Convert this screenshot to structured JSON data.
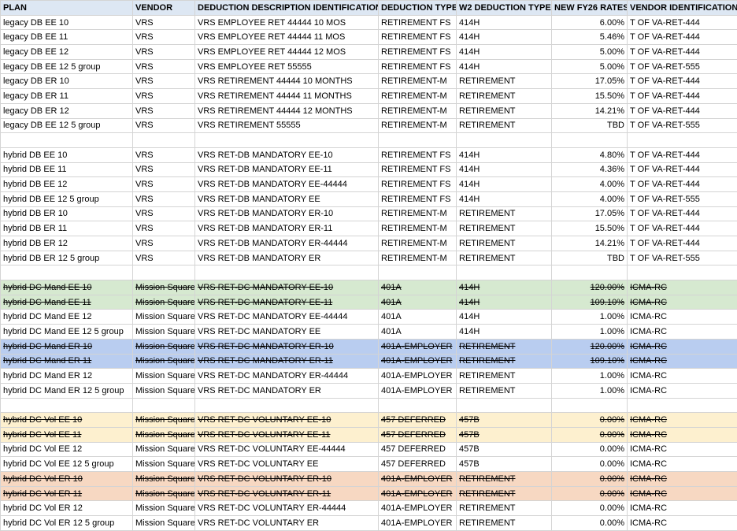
{
  "colors": {
    "header_fill": "#dde7f3",
    "green_fill": "#d6e9d0",
    "blue_fill": "#b9cdf0",
    "yellow_fill": "#fdf0cf",
    "orange_fill": "#f7d8c2",
    "grid": "#d4d4d4"
  },
  "headers": [
    "PLAN",
    "VENDOR",
    "DEDUCTION DESCRIPTION IDENTIFICATION",
    "DEDUCTION TYPE",
    "W2 DEDUCTION TYPE",
    "NEW FY26 RATES",
    "VENDOR IDENTIFICATION"
  ],
  "rows": [
    {
      "cells": [
        "legacy DB EE 10",
        "VRS",
        "VRS EMPLOYEE RET 44444 10 MOS",
        "RETIREMENT FS",
        "414H",
        "6.00%",
        "T OF VA-RET-444"
      ],
      "fill": "",
      "strike": false
    },
    {
      "cells": [
        "legacy DB EE 11",
        "VRS",
        "VRS EMPLOYEE RET 44444 11 MOS",
        "RETIREMENT FS",
        "414H",
        "5.46%",
        "T OF VA-RET-444"
      ],
      "fill": "",
      "strike": false
    },
    {
      "cells": [
        "legacy DB EE 12",
        "VRS",
        "VRS EMPLOYEE RET 44444 12 MOS",
        "RETIREMENT FS",
        "414H",
        "5.00%",
        "T OF VA-RET-444"
      ],
      "fill": "",
      "strike": false
    },
    {
      "cells": [
        "legacy DB EE 12 5 group",
        "VRS",
        "VRS EMPLOYEE RET 55555",
        "RETIREMENT FS",
        "414H",
        "5.00%",
        "T OF VA-RET-555"
      ],
      "fill": "",
      "strike": false
    },
    {
      "cells": [
        "legacy DB ER 10",
        "VRS",
        "VRS RETIREMENT 44444 10 MONTHS",
        "RETIREMENT-M",
        "RETIREMENT",
        "17.05%",
        "T OF VA-RET-444"
      ],
      "fill": "",
      "strike": false
    },
    {
      "cells": [
        "legacy DB ER 11",
        "VRS",
        "VRS RETIREMENT 44444 11 MONTHS",
        "RETIREMENT-M",
        "RETIREMENT",
        "15.50%",
        "T OF VA-RET-444"
      ],
      "fill": "",
      "strike": false
    },
    {
      "cells": [
        "legacy DB ER 12",
        "VRS",
        "VRS RETIREMENT 44444 12 MONTHS",
        "RETIREMENT-M",
        "RETIREMENT",
        "14.21%",
        "T OF VA-RET-444"
      ],
      "fill": "",
      "strike": false
    },
    {
      "cells": [
        "legacy DB EE 12 5 group",
        "VRS",
        "VRS RETIREMENT 55555",
        "RETIREMENT-M",
        "RETIREMENT",
        "TBD",
        "T OF VA-RET-555"
      ],
      "fill": "",
      "strike": false
    },
    {
      "cells": [
        "",
        "",
        "",
        "",
        "",
        "",
        ""
      ],
      "fill": "blank",
      "strike": false
    },
    {
      "cells": [
        "hybrid DB EE 10",
        "VRS",
        "VRS RET-DB MANDATORY EE-10",
        "RETIREMENT FS",
        "414H",
        "4.80%",
        "T OF VA-RET-444"
      ],
      "fill": "",
      "strike": false
    },
    {
      "cells": [
        "hybrid DB EE 11",
        "VRS",
        "VRS RET-DB MANDATORY EE-11",
        "RETIREMENT FS",
        "414H",
        "4.36%",
        "T OF VA-RET-444"
      ],
      "fill": "",
      "strike": false
    },
    {
      "cells": [
        "hybrid DB EE 12",
        "VRS",
        "VRS RET-DB MANDATORY EE-44444",
        "RETIREMENT FS",
        "414H",
        "4.00%",
        "T OF VA-RET-444"
      ],
      "fill": "",
      "strike": false
    },
    {
      "cells": [
        "hybrid DB EE 12 5 group",
        "VRS",
        "VRS RET-DB MANDATORY EE",
        "RETIREMENT FS",
        "414H",
        "4.00%",
        "T OF VA-RET-555"
      ],
      "fill": "",
      "strike": false
    },
    {
      "cells": [
        "hybrid DB ER 10",
        "VRS",
        "VRS RET-DB MANDATORY ER-10",
        "RETIREMENT-M",
        "RETIREMENT",
        "17.05%",
        "T OF VA-RET-444"
      ],
      "fill": "",
      "strike": false
    },
    {
      "cells": [
        "hybrid DB ER 11",
        "VRS",
        "VRS RET-DB MANDATORY ER-11",
        "RETIREMENT-M",
        "RETIREMENT",
        "15.50%",
        "T OF VA-RET-444"
      ],
      "fill": "",
      "strike": false
    },
    {
      "cells": [
        "hybrid DB ER 12",
        "VRS",
        "VRS RET-DB MANDATORY ER-44444",
        "RETIREMENT-M",
        "RETIREMENT",
        "14.21%",
        "T OF VA-RET-444"
      ],
      "fill": "",
      "strike": false
    },
    {
      "cells": [
        "hybrid DB ER 12 5 group",
        "VRS",
        "VRS RET-DB MANDATORY ER",
        "RETIREMENT-M",
        "RETIREMENT",
        "TBD",
        "T OF VA-RET-555"
      ],
      "fill": "",
      "strike": false
    },
    {
      "cells": [
        "",
        "",
        "",
        "",
        "",
        "",
        ""
      ],
      "fill": "blank",
      "strike": false
    },
    {
      "cells": [
        "hybrid DC Mand EE 10",
        "Mission Square",
        "VRS RET-DC MANDATORY EE-10",
        "401A",
        "414H",
        "120.00%",
        "ICMA-RC"
      ],
      "fill": "green",
      "strike": true
    },
    {
      "cells": [
        "hybrid DC Mand EE 11",
        "Mission Square",
        "VRS RET-DC MANDATORY EE-11",
        "401A",
        "414H",
        "109.10%",
        "ICMA-RC"
      ],
      "fill": "green",
      "strike": true
    },
    {
      "cells": [
        "hybrid DC Mand EE 12",
        "Mission Square",
        "VRS RET-DC MANDATORY EE-44444",
        "401A",
        "414H",
        "1.00%",
        "ICMA-RC"
      ],
      "fill": "",
      "strike": false
    },
    {
      "cells": [
        "hybrid DC Mand EE 12 5 group",
        "Mission Square",
        "VRS RET-DC MANDATORY EE",
        "401A",
        "414H",
        "1.00%",
        "ICMA-RC"
      ],
      "fill": "",
      "strike": false
    },
    {
      "cells": [
        "hybrid DC Mand ER 10",
        "Mission Square",
        "VRS RET-DC MANDATORY ER-10",
        "401A-EMPLOYER",
        "RETIREMENT",
        "120.00%",
        "ICMA-RC"
      ],
      "fill": "blue",
      "strike": true
    },
    {
      "cells": [
        "hybrid DC Mand ER 11",
        "Mission Square",
        "VRS RET-DC MANDATORY ER-11",
        "401A-EMPLOYER",
        "RETIREMENT",
        "109.10%",
        "ICMA-RC"
      ],
      "fill": "blue",
      "strike": true
    },
    {
      "cells": [
        "hybrid DC Mand ER 12",
        "Mission Square",
        "VRS RET-DC MANDATORY ER-44444",
        "401A-EMPLOYER",
        "RETIREMENT",
        "1.00%",
        "ICMA-RC"
      ],
      "fill": "",
      "strike": false
    },
    {
      "cells": [
        "hybrid DC Mand ER 12 5 group",
        "Mission Square",
        "VRS RET-DC MANDATORY ER",
        "401A-EMPLOYER",
        "RETIREMENT",
        "1.00%",
        "ICMA-RC"
      ],
      "fill": "",
      "strike": false
    },
    {
      "cells": [
        "",
        "",
        "",
        "",
        "",
        "",
        ""
      ],
      "fill": "blank",
      "strike": false
    },
    {
      "cells": [
        "hybrid DC Vol EE 10",
        "Mission Square",
        "VRS RET-DC VOLUNTARY EE-10",
        "457 DEFERRED",
        "457B",
        "0.00%",
        "ICMA-RC"
      ],
      "fill": "yellow",
      "strike": true
    },
    {
      "cells": [
        "hybrid DC Vol EE 11",
        "Mission Square",
        "VRS RET-DC VOLUNTARY EE-11",
        "457 DEFERRED",
        "457B",
        "0.00%",
        "ICMA-RC"
      ],
      "fill": "yellow",
      "strike": true
    },
    {
      "cells": [
        "hybrid DC Vol EE 12",
        "Mission Square",
        "VRS RET-DC VOLUNTARY EE-44444",
        "457 DEFERRED",
        "457B",
        "0.00%",
        "ICMA-RC"
      ],
      "fill": "",
      "strike": false
    },
    {
      "cells": [
        "hybrid DC Vol EE 12 5 group",
        "Mission Square",
        "VRS RET-DC VOLUNTARY EE",
        "457 DEFERRED",
        "457B",
        "0.00%",
        "ICMA-RC"
      ],
      "fill": "",
      "strike": false
    },
    {
      "cells": [
        "hybrid DC Vol ER 10",
        "Mission Square",
        "VRS RET-DC VOLUNTARY ER-10",
        "401A-EMPLOYER",
        "RETIREMENT",
        "0.00%",
        "ICMA-RC"
      ],
      "fill": "orange",
      "strike": true
    },
    {
      "cells": [
        "hybrid DC Vol ER 11",
        "Mission Square",
        "VRS RET-DC VOLUNTARY ER-11",
        "401A-EMPLOYER",
        "RETIREMENT",
        "0.00%",
        "ICMA-RC"
      ],
      "fill": "orange",
      "strike": true
    },
    {
      "cells": [
        "hybrid DC Vol ER 12",
        "Mission Square",
        "VRS RET-DC VOLUNTARY ER-44444",
        "401A-EMPLOYER",
        "RETIREMENT",
        "0.00%",
        "ICMA-RC"
      ],
      "fill": "",
      "strike": false
    },
    {
      "cells": [
        "hybrid DC Vol ER 12 5 group",
        "Mission Square",
        "VRS RET-DC VOLUNTARY ER",
        "401A-EMPLOYER",
        "RETIREMENT",
        "0.00%",
        "ICMA-RC"
      ],
      "fill": "",
      "strike": false
    }
  ]
}
